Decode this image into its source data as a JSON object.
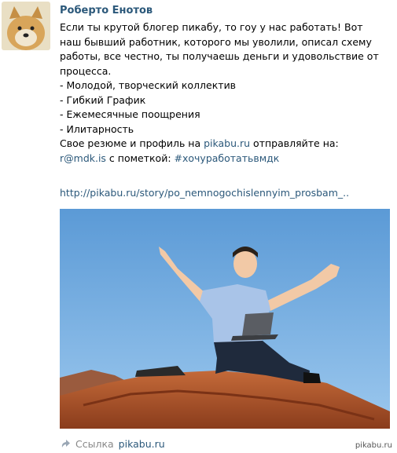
{
  "post": {
    "author": "Роберто Енотов",
    "lines": {
      "l1": "Если ты крутой блогер пикабу, то гоу у нас работать! Вот",
      "l2": "наш бывший работник, которого мы уволили, описал схему",
      "l3": "работы, все честно, ты получаешь деньги и удовольствие от",
      "l4": "процесса.",
      "b1": "- Молодой, творческий коллектив",
      "b2": "- Гибкий График",
      "b3": "- Ежемесячные поощрения",
      "b4": "- Илитарность",
      "send_prefix": "Свое резюме и профиль на ",
      "send_link": "pikabu.ru",
      "send_suffix": " отправляйте на:",
      "email": "r@mdk.is",
      "mark_text": " с пометкой: ",
      "hashtag": "#хочуработатьвмдк"
    },
    "story_link": "http://pikabu.ru/story/po_nemnogochislennyim_prosbam_..",
    "source_label": "Ссылка",
    "source_link": "pikabu.ru"
  },
  "watermark": "pikabu.ru",
  "colors": {
    "link": "#2b587a",
    "sky": "#6ea9dc",
    "rock": "#b55a2e"
  },
  "icons": {
    "avatar": "doge-avatar",
    "source": "link-arrow-icon"
  }
}
